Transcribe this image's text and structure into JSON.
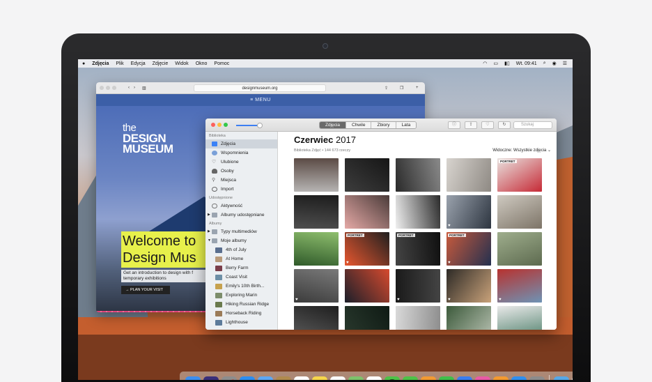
{
  "menubar": {
    "apple": "",
    "items": [
      "Zdjęcia",
      "Plik",
      "Edycja",
      "Zdjęcie",
      "Widok",
      "Okno",
      "Pomoc"
    ],
    "clock": "Wt. 09:41"
  },
  "safari": {
    "url": "designmuseum.org",
    "nav_label": "≡ MENU",
    "logo_lines": [
      "the",
      "DESIGN",
      "MUSEUM"
    ],
    "welcome_lines": [
      "Welcome to",
      "Design Mus"
    ],
    "intro_lines": [
      "Get an introduction to design with f",
      "temporary exhibitions"
    ],
    "cta": "→ PLAN YOUR VISIT"
  },
  "photos": {
    "tabs": [
      {
        "label": "Zdjęcia",
        "active": true
      },
      {
        "label": "Chwile",
        "active": false
      },
      {
        "label": "Zbiory",
        "active": false
      },
      {
        "label": "Lata",
        "active": false
      }
    ],
    "search_placeholder": "Szukaj",
    "sidebar": {
      "section_library": "Biblioteka",
      "library": [
        {
          "label": "Zdjęcia",
          "icon": "photos-icon",
          "selected": true
        },
        {
          "label": "Wspomnienia",
          "icon": "memories-icon",
          "selected": false
        },
        {
          "label": "Ulubione",
          "icon": "heart-icon",
          "selected": false
        },
        {
          "label": "Osoby",
          "icon": "person-icon",
          "selected": false
        },
        {
          "label": "Miejsca",
          "icon": "pin-icon",
          "selected": false
        },
        {
          "label": "Import",
          "icon": "import-icon",
          "selected": false
        }
      ],
      "section_shared": "Udostępnione",
      "shared": [
        {
          "label": "Aktywność",
          "icon": "cloud-icon"
        },
        {
          "label": "Albumy udostępniane",
          "icon": "shared-albums-icon"
        }
      ],
      "section_albums": "Albumy",
      "album_groups": [
        {
          "label": "Typy multimediów",
          "icon": "folder-icon",
          "caret": "▶"
        },
        {
          "label": "Moje albumy",
          "icon": "folder-icon",
          "caret": "▼"
        }
      ],
      "albums": [
        "4th of July",
        "At Home",
        "Berry Farm",
        "Coast Visit",
        "Emily's 10th Birth...",
        "Exploring Marin",
        "Hiking Russian Ridge",
        "Horseback Riding",
        "Lighthouse"
      ]
    },
    "title_month": "Czerwiec",
    "title_year": "2017",
    "subtitle": "Biblioteka Zdjęć • 144 673 rzeczy",
    "visible_filter": "Widoczne: Wszystkie zdjęcia ⌄",
    "badge_text": "PORTRET",
    "heart_glyph": "♥",
    "grid": [
      {
        "c1": "#b6b4b3",
        "c2": "#5b4b45",
        "badge": false,
        "heart": false
      },
      {
        "c1": "#3d3d3d",
        "c2": "#161616",
        "badge": false,
        "heart": false
      },
      {
        "c1": "#2a2a2a",
        "c2": "#8a8a8a",
        "badge": false,
        "heart": false
      },
      {
        "c1": "#d8d4cf",
        "c2": "#8e8983",
        "badge": false,
        "heart": false
      },
      {
        "c1": "#e9e3e0",
        "c2": "#c62a36",
        "badge": true,
        "heart": false
      },
      {
        "c1": "#4f4f4f",
        "c2": "#1c1c1c",
        "badge": false,
        "heart": false
      },
      {
        "c1": "#e5a9a6",
        "c2": "#4a3b39",
        "badge": false,
        "heart": false
      },
      {
        "c1": "#f0f0f0",
        "c2": "#2b2b2b",
        "badge": false,
        "heart": false
      },
      {
        "c1": "#9aa2ad",
        "c2": "#2d3540",
        "badge": false,
        "heart": true
      },
      {
        "c1": "#cfcac1",
        "c2": "#7d7467",
        "badge": false,
        "heart": false
      },
      {
        "c1": "#2f5a2a",
        "c2": "#8fbf6e",
        "badge": false,
        "heart": false
      },
      {
        "c1": "#e7572f",
        "c2": "#1f1f1f",
        "badge": true,
        "heart": true
      },
      {
        "c1": "#444444",
        "c2": "#101010",
        "badge": true,
        "heart": false
      },
      {
        "c1": "#c85a3c",
        "c2": "#23304f",
        "badge": true,
        "heart": true
      },
      {
        "c1": "#9fae8d",
        "c2": "#5d6a4f",
        "badge": false,
        "heart": false
      },
      {
        "c1": "#3b3b3b",
        "c2": "#7a7a7a",
        "badge": false,
        "heart": true
      },
      {
        "c1": "#1b1f2a",
        "c2": "#d64a2e",
        "badge": false,
        "heart": false
      },
      {
        "c1": "#1a1a1a",
        "c2": "#444444",
        "badge": false,
        "heart": true
      },
      {
        "c1": "#2d2a26",
        "c2": "#c9a27a",
        "badge": false,
        "heart": true
      },
      {
        "c1": "#b8322f",
        "c2": "#6e93b5",
        "badge": false,
        "heart": true
      },
      {
        "c1": "#5c5c5c",
        "c2": "#1e1e1e",
        "badge": false,
        "heart": false
      },
      {
        "c1": "#2a3a2e",
        "c2": "#0f1a14",
        "badge": false,
        "heart": false
      },
      {
        "c1": "#d9d9d9",
        "c2": "#8d8d8d",
        "badge": false,
        "heart": false
      },
      {
        "c1": "#3c5a3b",
        "c2": "#b9c2b3",
        "badge": false,
        "heart": false
      },
      {
        "c1": "#e9e9e9",
        "c2": "#4d7f6a",
        "badge": false,
        "heart": false
      }
    ]
  },
  "dock": [
    {
      "name": "finder-icon",
      "color": "#3b8ef0",
      "glyph": ""
    },
    {
      "name": "siri-icon",
      "color": "#3a2f7a",
      "glyph": "◉"
    },
    {
      "name": "launchpad-icon",
      "color": "#8d8d8d",
      "glyph": "🚀"
    },
    {
      "name": "safari-icon",
      "color": "#2c8ef2",
      "glyph": "◎"
    },
    {
      "name": "mail-icon",
      "color": "#5da7f5",
      "glyph": "✉"
    },
    {
      "name": "notes-folder-icon",
      "color": "#b08a4e",
      "glyph": "▤"
    },
    {
      "name": "calendar-icon",
      "color": "#ffffff",
      "glyph": "12"
    },
    {
      "name": "notes-icon",
      "color": "#f6d64b",
      "glyph": "≡"
    },
    {
      "name": "reminders-icon",
      "color": "#fafafa",
      "glyph": "☑"
    },
    {
      "name": "maps-icon",
      "color": "#7dc26b",
      "glyph": "➤"
    },
    {
      "name": "photos-app-icon",
      "color": "#ffffff",
      "glyph": "✿"
    },
    {
      "name": "messages-icon",
      "color": "#4dc247",
      "glyph": "💬"
    },
    {
      "name": "facetime-icon",
      "color": "#4dc247",
      "glyph": "▶"
    },
    {
      "name": "pages-icon",
      "color": "#f29a32",
      "glyph": "✎"
    },
    {
      "name": "numbers-icon",
      "color": "#3fbf4a",
      "glyph": "▥"
    },
    {
      "name": "keynote-icon",
      "color": "#3a7df0",
      "glyph": "▲"
    },
    {
      "name": "itunes-icon",
      "color": "#e95aa6",
      "glyph": "♪"
    },
    {
      "name": "ibooks-icon",
      "color": "#f49a2f",
      "glyph": "📖"
    },
    {
      "name": "app-store-icon",
      "color": "#2e8ff0",
      "glyph": "A"
    },
    {
      "name": "system-prefs-icon",
      "color": "#8c8c8c",
      "glyph": "⚙"
    },
    {
      "name": "downloads-folder-icon",
      "color": "#56a8e8",
      "glyph": "⬇"
    },
    {
      "name": "trash-icon",
      "color": "#e4e4e4",
      "glyph": "🗑"
    }
  ]
}
